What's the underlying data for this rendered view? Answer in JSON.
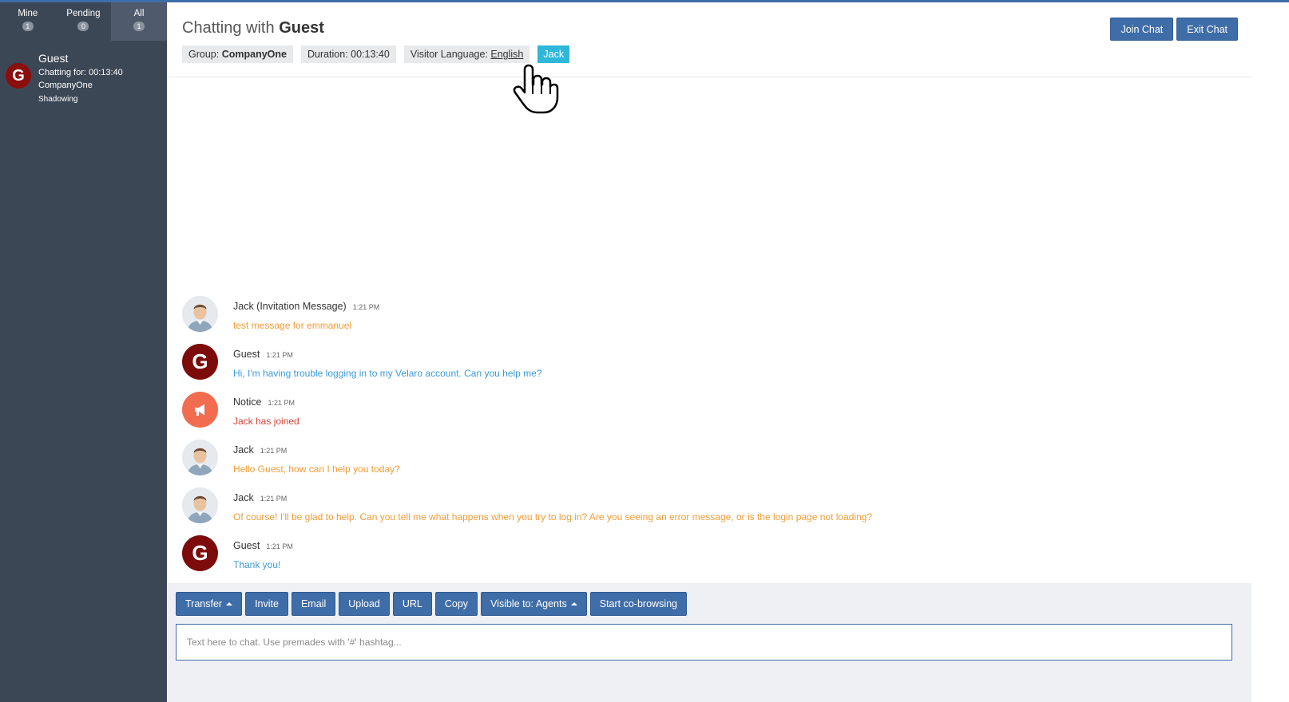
{
  "sidebar": {
    "tabs": [
      {
        "label": "Mine",
        "count": "1"
      },
      {
        "label": "Pending",
        "count": "0"
      },
      {
        "label": "All",
        "count": "1"
      }
    ],
    "chat": {
      "avatar_letter": "G",
      "name": "Guest",
      "duration": "Chatting for: 00:13:40",
      "company": "CompanyOne",
      "status": "Shadowing"
    }
  },
  "header": {
    "title_prefix": "Chatting with",
    "title_name": "Guest",
    "group_label": "Group:",
    "group_value": "CompanyOne",
    "duration": "Duration: 00:13:40",
    "language_label": "Visitor Language:",
    "language_value": "English",
    "agent_tag": "Jack",
    "join_label": "Join Chat",
    "exit_label": "Exit Chat"
  },
  "messages": [
    {
      "author": "Jack (Invitation Message)",
      "time": "1:21 PM",
      "text": "test message for emmanuel",
      "type": "agent"
    },
    {
      "author": "Guest",
      "time": "1:21 PM",
      "text": "Hi, I'm having trouble logging in to my Velaro account. Can you help me?",
      "type": "guest",
      "avatar_letter": "G"
    },
    {
      "author": "Notice",
      "time": "1:21 PM",
      "text": "Jack has joined",
      "type": "notice"
    },
    {
      "author": "Jack",
      "time": "1:21 PM",
      "text": "Hello Guest, how can I help you today?",
      "type": "agent"
    },
    {
      "author": "Jack",
      "time": "1:21 PM",
      "text": "Of course! I'll be glad to help. Can you tell me what happens when you try to log in? Are you seeing an error message, or is the login page not loading?",
      "type": "agent"
    },
    {
      "author": "Guest",
      "time": "1:21 PM",
      "text": "Thank you!",
      "type": "guest",
      "avatar_letter": "G"
    }
  ],
  "composer": {
    "transfer": "Transfer",
    "invite": "Invite",
    "email": "Email",
    "upload": "Upload",
    "url": "URL",
    "copy": "Copy",
    "visible": "Visible to: Agents",
    "cobrowse": "Start co-browsing",
    "placeholder": "Text here to chat. Use premades with '#' hashtag..."
  },
  "colors": {
    "primary": "#3f6da8",
    "sidebar": "#3c4756",
    "agent_text": "#f29d38",
    "guest_text": "#3b9bd8",
    "notice_text": "#d9443a",
    "guest_avatar": "#7d0b0b",
    "notice_avatar": "#f26c4f",
    "agent_tag": "#2fb7d9"
  },
  "icons": {
    "notice": "megaphone-icon",
    "cursor": "hand-pointer-icon",
    "caret": "caret-up-icon"
  }
}
